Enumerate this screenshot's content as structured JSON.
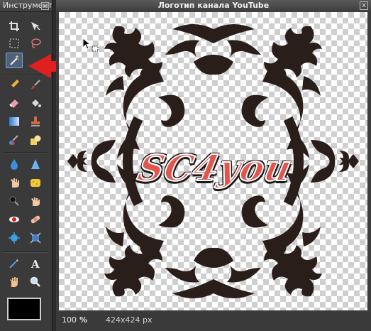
{
  "tools_panel": {
    "title": "Инструмент",
    "close": "x",
    "tools": [
      {
        "name": "crop-icon"
      },
      {
        "name": "move-icon"
      },
      {
        "name": "marquee-icon"
      },
      {
        "name": "lasso-icon"
      },
      {
        "name": "magic-wand-icon",
        "selected": true
      },
      {
        "name": "pencil-icon"
      },
      {
        "name": "brush-icon"
      },
      {
        "name": "eraser-icon"
      },
      {
        "name": "paint-bucket-icon"
      },
      {
        "name": "gradient-icon"
      },
      {
        "name": "clone-stamp-icon"
      },
      {
        "name": "color-replace-icon"
      },
      {
        "name": "drawing-icon"
      },
      {
        "name": "blur-icon"
      },
      {
        "name": "sharpen-icon"
      },
      {
        "name": "smudge-icon"
      },
      {
        "name": "sponge-icon"
      },
      {
        "name": "burn-icon"
      },
      {
        "name": "dodge-icon"
      },
      {
        "name": "red-eye-icon"
      },
      {
        "name": "spot-heal-icon"
      },
      {
        "name": "bloat-icon"
      },
      {
        "name": "pinch-icon"
      },
      {
        "name": "color-picker-icon"
      },
      {
        "name": "type-icon"
      },
      {
        "name": "hand-icon"
      },
      {
        "name": "zoom-icon"
      }
    ],
    "primary_color": "#000000"
  },
  "document": {
    "title": "Логотип канала YouTube",
    "close": "x",
    "logo_text": "SC4you"
  },
  "statusbar": {
    "zoom": "100",
    "zoom_unit": "%",
    "dimensions": "424x424 px"
  },
  "colors": {
    "annotation_arrow": "#e0201e",
    "ornament": "#2a1e1a",
    "logo_fill": "#e0564e"
  }
}
